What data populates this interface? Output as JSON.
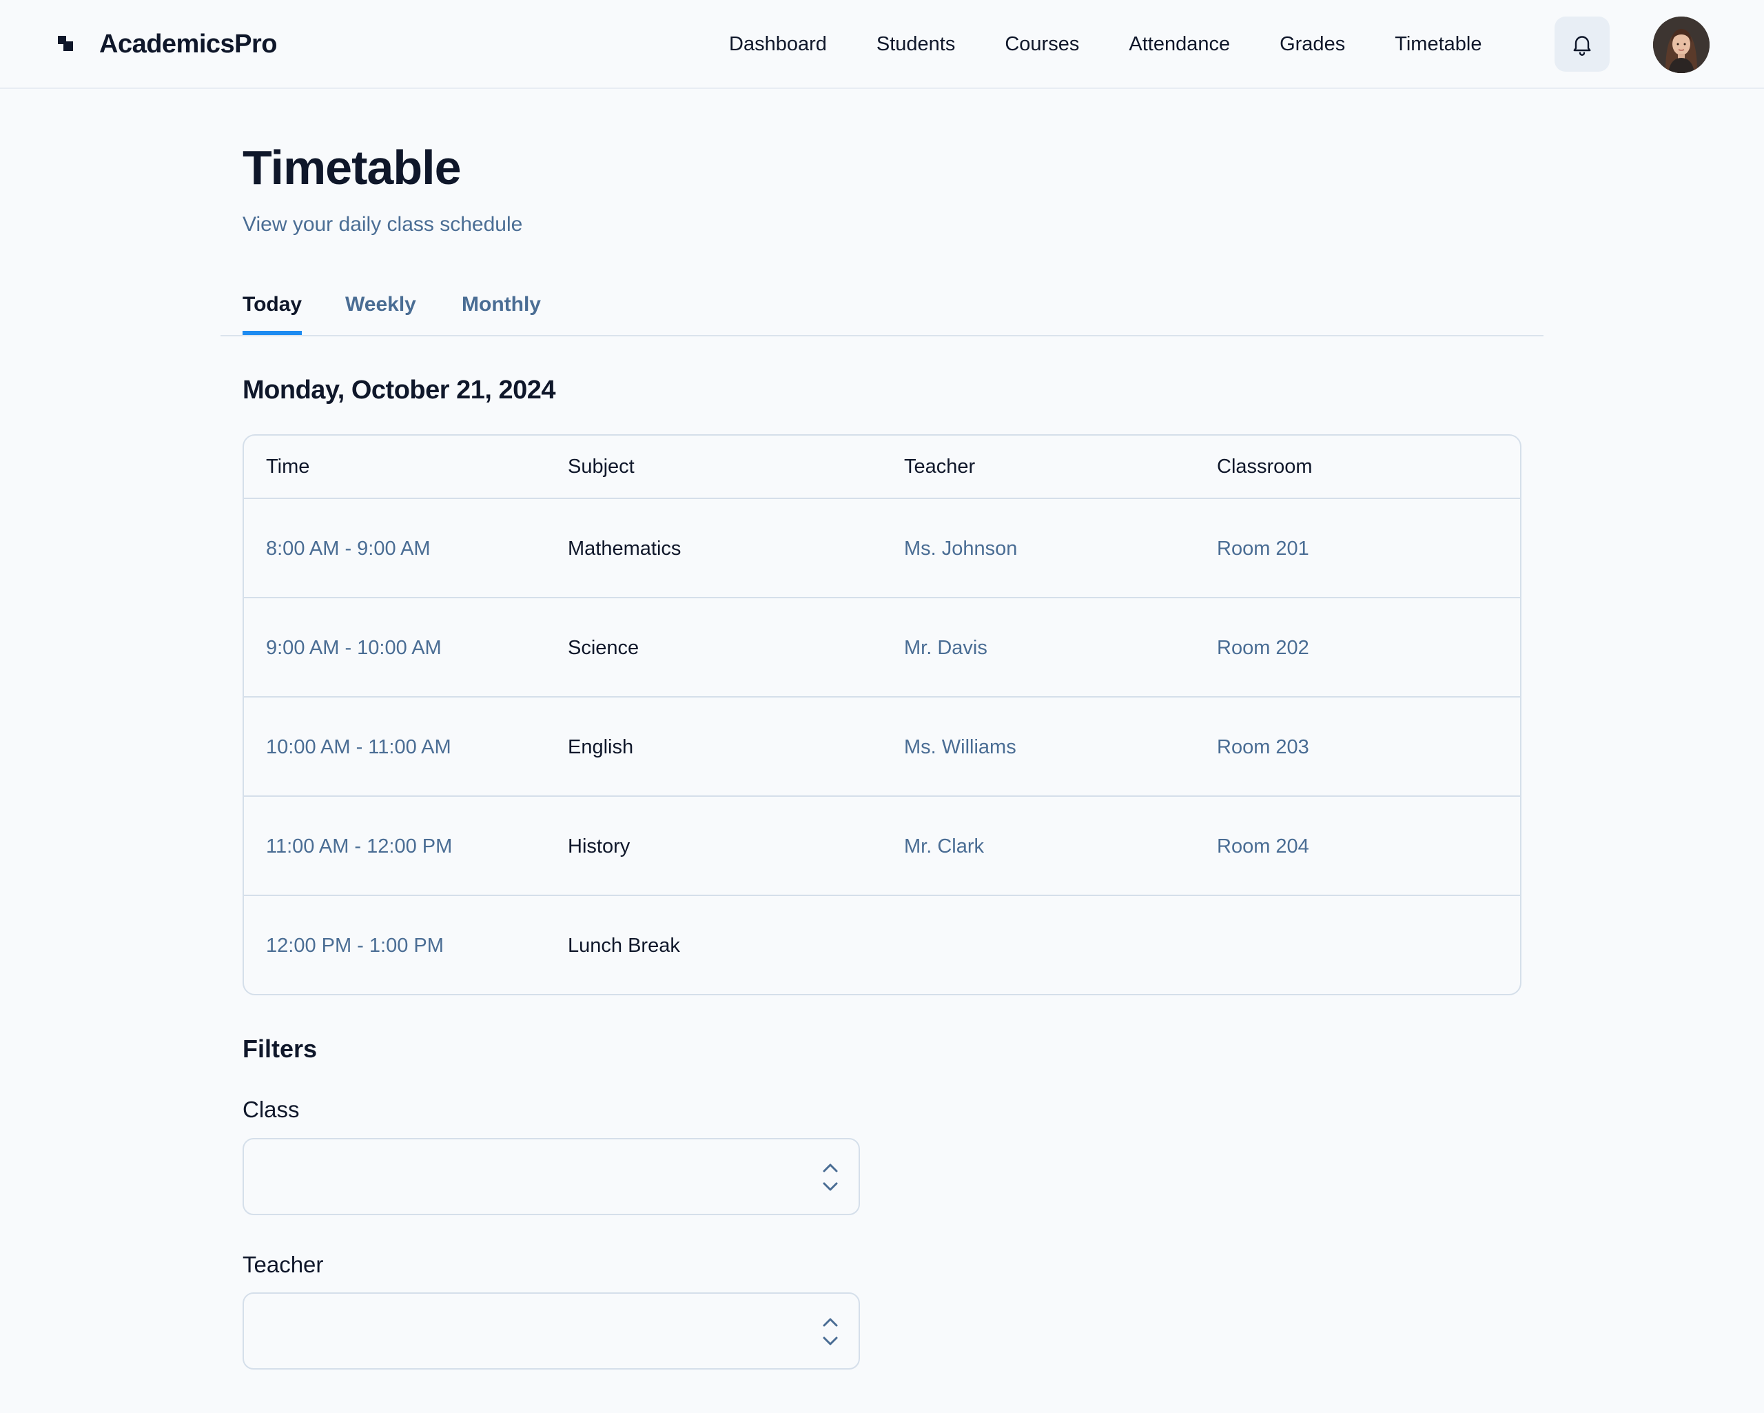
{
  "app": {
    "name": "AcademicsPro",
    "logo_icon": "stacked-squares-logo"
  },
  "nav": {
    "items": [
      {
        "label": "Dashboard"
      },
      {
        "label": "Students"
      },
      {
        "label": "Courses"
      },
      {
        "label": "Attendance"
      },
      {
        "label": "Grades"
      },
      {
        "label": "Timetable"
      }
    ],
    "notifications_icon": "bell-icon"
  },
  "page": {
    "title": "Timetable",
    "subtitle": "View your daily class schedule"
  },
  "tabs": [
    {
      "label": "Today",
      "active": true
    },
    {
      "label": "Weekly",
      "active": false
    },
    {
      "label": "Monthly",
      "active": false
    }
  ],
  "schedule": {
    "date": "Monday, October 21, 2024",
    "columns": [
      "Time",
      "Subject",
      "Teacher",
      "Classroom"
    ],
    "rows": [
      {
        "time": "8:00 AM - 9:00 AM",
        "subject": "Mathematics",
        "teacher": "Ms. Johnson",
        "classroom": "Room 201"
      },
      {
        "time": "9:00 AM - 10:00 AM",
        "subject": "Science",
        "teacher": "Mr. Davis",
        "classroom": "Room 202"
      },
      {
        "time": "10:00 AM - 11:00 AM",
        "subject": "English",
        "teacher": "Ms. Williams",
        "classroom": "Room 203"
      },
      {
        "time": "11:00 AM - 12:00 PM",
        "subject": "History",
        "teacher": "Mr. Clark",
        "classroom": "Room 204"
      },
      {
        "time": "12:00 PM - 1:00 PM",
        "subject": "Lunch Break",
        "teacher": "",
        "classroom": ""
      }
    ]
  },
  "filters": {
    "heading": "Filters",
    "class": {
      "label": "Class",
      "value": ""
    },
    "teacher": {
      "label": "Teacher",
      "value": ""
    }
  },
  "colors": {
    "accent": "#1d8bf1",
    "muted_text": "#4a6d94",
    "border": "#d5dfea",
    "background": "#f8fafc",
    "bell_button_bg": "#e8eef5"
  }
}
